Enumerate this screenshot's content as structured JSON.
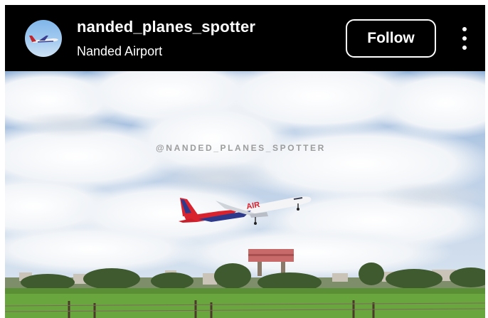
{
  "post_header": {
    "username": "nanded_planes_spotter",
    "location": "Nanded Airport",
    "follow_label": "Follow",
    "avatar_icon": "airplane-avatar-icon",
    "more_icon": "more-vertical-icon"
  },
  "photo": {
    "watermark": "@NANDED_PLANES_SPOTTER",
    "aircraft_livery_text": "AIR"
  },
  "colors": {
    "header_background": "#000000",
    "text": "#ffffff",
    "follow_border": "#ffffff"
  }
}
